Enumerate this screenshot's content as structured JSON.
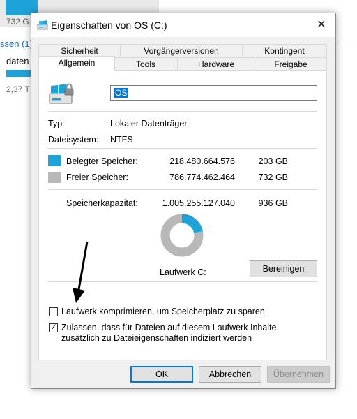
{
  "background": {
    "drive_size": "732 G",
    "group_header": "ssen (1)",
    "drive_name": "daten",
    "drive_size2": "2,37 T"
  },
  "dialog": {
    "title": "Eigenschaften von OS (C:)",
    "close_label": "✕",
    "tabs_row1": [
      "Sicherheit",
      "Vorgängerversionen",
      "Kontingent"
    ],
    "tabs_row2": [
      "Allgemein",
      "Tools",
      "Hardware",
      "Freigabe"
    ],
    "active_tab": "Allgemein",
    "drive_label_value": "OS",
    "type_label": "Typ:",
    "type_value": "Lokaler Datenträger",
    "fs_label": "Dateisystem:",
    "fs_value": "NTFS",
    "used_label": "Belegter Speicher:",
    "used_bytes": "218.480.664.576",
    "used_gb": "203 GB",
    "free_label": "Freier Speicher:",
    "free_bytes": "786.774.462.464",
    "free_gb": "732 GB",
    "capacity_label": "Speicherkapazität:",
    "capacity_bytes": "1.005.255.127.040",
    "capacity_gb": "936 GB",
    "used_fraction": 0.217,
    "drive_caption": "Laufwerk C:",
    "cleanup_button": "Bereinigen",
    "compress_label": "Laufwerk komprimieren, um Speicherplatz zu sparen",
    "compress_checked": false,
    "index_label_line1": "Zulassen, dass für Dateien auf diesem Laufwerk Inhalte",
    "index_label_line2": "zusätzlich zu Dateieigenschaften indiziert werden",
    "index_checked": true,
    "ok_button": "OK",
    "cancel_button": "Abbrechen",
    "apply_button": "Übernehmen"
  },
  "colors": {
    "used": "#1ea3d8",
    "free": "#b8b8b8",
    "accent": "#0078d7"
  }
}
